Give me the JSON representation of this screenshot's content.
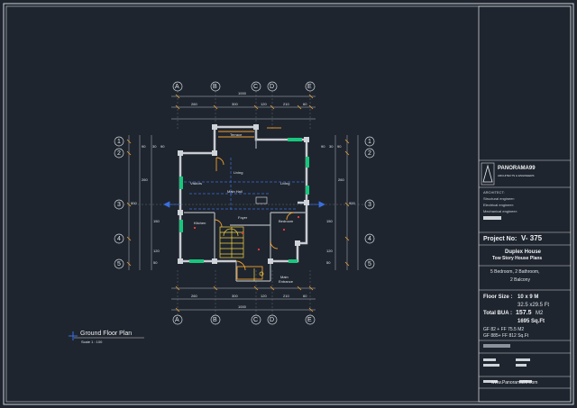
{
  "drawing": {
    "plan_title": "Ground Floor Plan",
    "plan_scale": "Scale  1 : 100",
    "rooms": {
      "terrace": "Terrace",
      "living_left": "Living",
      "living_right": "Living",
      "visitors": "Visitors",
      "main_hall": "Main Hall",
      "foyer": "Foyer",
      "kitchen": "Kitchen",
      "bedroom": "Bedroom",
      "main_entrance_1": "Main",
      "main_entrance_2": "Entrance"
    },
    "grid_top": [
      "A",
      "B",
      "C",
      "D",
      "E"
    ],
    "grid_bottom": [
      "A",
      "B",
      "C",
      "D",
      "E"
    ],
    "grid_left": [
      "1",
      "2",
      "3",
      "4",
      "5"
    ],
    "grid_right": [
      "1",
      "2",
      "3",
      "4",
      "5"
    ],
    "dims_top_total": "1000",
    "dims_top": [
      "260",
      "300",
      "120",
      "210",
      "60"
    ],
    "dims_bottom_total": "1000",
    "dims_bottom": [
      "260",
      "300",
      "120",
      "210",
      "60"
    ],
    "dims_left_total": "900",
    "dims_left": [
      "90",
      "30",
      "90",
      "260",
      "150",
      "120",
      "50"
    ],
    "dims_right_total": "900",
    "dims_right": [
      "90",
      "30",
      "90",
      "260",
      "150",
      "120",
      "50"
    ]
  },
  "title_block": {
    "brand": "PANORAMA99",
    "brand_sub": "ARCHITECTS & ENGINEERS",
    "info_lines": [
      "ARCHITECT:",
      "Structural engineer:",
      "Electrical engineer:",
      "Mechanical engineer:"
    ],
    "project_label": "Project No:",
    "project_no": "V- 375",
    "house_type_1": "Duplex House",
    "house_type_2": "Tow Story House Plans",
    "rooms_line_1": "5 Bedroom, 2 Bathroom,",
    "rooms_line_2": "2 Balcony",
    "floor_size_label": "Floor Size :",
    "floor_size": "10 x 9 M",
    "floor_size_ft": "32.5 x29.5 Ft",
    "total_bua_label": "Total BUA :",
    "total_bua": "157.5",
    "total_bua_unit": "M2",
    "total_bua_ft": "1695 Sq.Ft",
    "gf_line": "GF 82  + FF 75.5  M2",
    "gf_line_ft": "GF 885+ FF 812  Sq.Ft",
    "website": "www.Panorama99.com"
  }
}
